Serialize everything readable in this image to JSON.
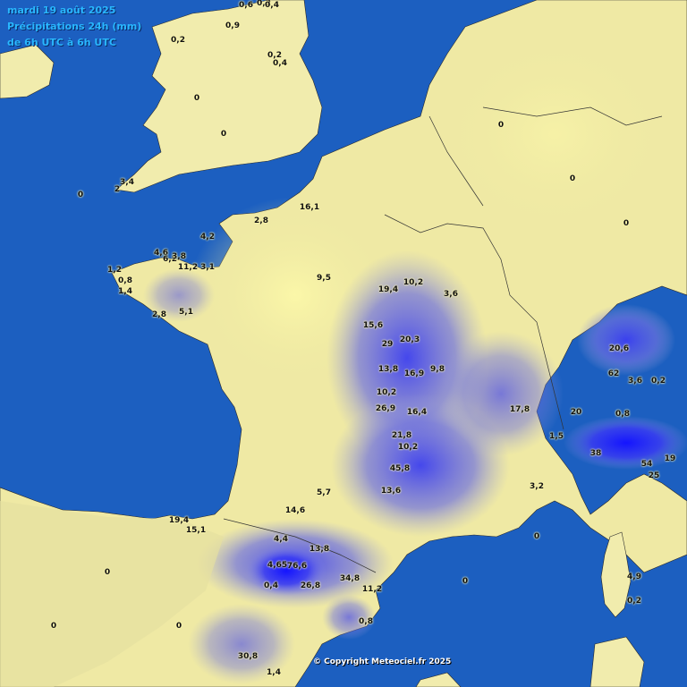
{
  "header": {
    "date": "mardi 19 août 2025",
    "title": "Précipitations 24h (mm)",
    "period": "de 6h UTC à 6h UTC"
  },
  "copyright": "© Copyright Meteociel.fr 2025",
  "colors": {
    "sea": "#1c5fc0",
    "land_dry": "#f3efb0",
    "land_low": "#e8e48e",
    "rain_light": "#8d8fd6",
    "rain_moderate": "#5a5ce6",
    "rain_heavy": "#2a2ef0",
    "header_text": "#29b7ff"
  },
  "legend_units": "mm",
  "observations": [
    {
      "label": "4,6"
    },
    {
      "label": "6,2"
    },
    {
      "label": "3,8"
    },
    {
      "label": "11,2"
    },
    {
      "label": "3,1"
    },
    {
      "label": "1,2"
    },
    {
      "label": "0,8"
    },
    {
      "label": "1,4"
    },
    {
      "label": "2,8"
    },
    {
      "label": "5,1"
    },
    {
      "label": "16,1"
    },
    {
      "label": "2,8"
    },
    {
      "label": "4,2"
    },
    {
      "label": "9,5"
    },
    {
      "label": "19,4"
    },
    {
      "label": "10,2"
    },
    {
      "label": "3,6"
    },
    {
      "label": "15,6"
    },
    {
      "label": "29"
    },
    {
      "label": "20,3"
    },
    {
      "label": "13,8"
    },
    {
      "label": "16,9"
    },
    {
      "label": "9,8"
    },
    {
      "label": "10,2"
    },
    {
      "label": "26,9"
    },
    {
      "label": "16,4"
    },
    {
      "label": "21,8"
    },
    {
      "label": "10,2"
    },
    {
      "label": "45,8"
    },
    {
      "label": "13,6"
    },
    {
      "label": "5,7"
    },
    {
      "label": "14,6"
    },
    {
      "label": "19,4"
    },
    {
      "label": "15,1"
    },
    {
      "label": "4,4"
    },
    {
      "label": "13,8"
    },
    {
      "label": "4,65"
    },
    {
      "label": "76,6"
    },
    {
      "label": "26,8"
    },
    {
      "label": "34,8"
    },
    {
      "label": "11,2"
    },
    {
      "label": "0,4"
    },
    {
      "label": "30,8"
    },
    {
      "label": "1,4"
    },
    {
      "label": "0,8"
    },
    {
      "label": "62"
    },
    {
      "label": "3,6"
    },
    {
      "label": "0,2"
    },
    {
      "label": "20,6"
    },
    {
      "label": "38"
    },
    {
      "label": "54"
    },
    {
      "label": "25"
    },
    {
      "label": "19"
    },
    {
      "label": "20"
    },
    {
      "label": "17,8"
    },
    {
      "label": "3,2"
    },
    {
      "label": "4,9"
    },
    {
      "label": "0,2"
    },
    {
      "label": "1,5"
    },
    {
      "label": "0,8"
    },
    {
      "label": "3,4"
    },
    {
      "label": "2"
    },
    {
      "label": "0,4"
    },
    {
      "label": "0,2"
    },
    {
      "label": "0,6"
    },
    {
      "label": "0,2"
    },
    {
      "label": "0,9"
    },
    {
      "label": "0,4"
    },
    {
      "label": "0,2"
    },
    {
      "label": "0"
    },
    {
      "label": "0"
    },
    {
      "label": "0"
    },
    {
      "label": "0"
    },
    {
      "label": "0"
    },
    {
      "label": "0"
    },
    {
      "label": "0"
    },
    {
      "label": "0"
    },
    {
      "label": "0"
    },
    {
      "label": "0"
    },
    {
      "label": "0"
    }
  ]
}
